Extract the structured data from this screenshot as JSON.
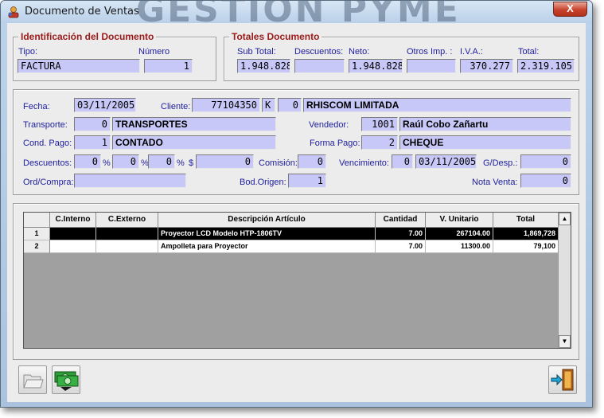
{
  "window": {
    "title": "Documento de Ventas",
    "watermark": "GESTION PYME",
    "close_label": "X"
  },
  "identificacion": {
    "title": "Identificación del Documento",
    "tipo_label": "Tipo:",
    "tipo_value": "FACTURA",
    "numero_label": "Número",
    "numero_value": "1"
  },
  "totales": {
    "title": "Totales Documento",
    "subtotal_label": "Sub Total:",
    "subtotal_value": "1.948.828",
    "descuentos_label": "Descuentos:",
    "descuentos_value": "",
    "neto_label": "Neto:",
    "neto_value": "1.948.828",
    "otros_label": "Otros Imp. :",
    "otros_value": "",
    "iva_label": "I.V.A.:",
    "iva_value": "370.277",
    "total_label": "Total:",
    "total_value": "2.319.105"
  },
  "form": {
    "fecha_label": "Fecha:",
    "fecha_value": "03/11/2005",
    "cliente_label": "Cliente:",
    "cliente_rut": "77104350",
    "cliente_dv": "K",
    "cliente_suc": "0",
    "cliente_nombre": "RHISCOM  LIMITADA",
    "transporte_label": "Transporte:",
    "transporte_code": "0",
    "transporte_name": "TRANSPORTES",
    "vendedor_label": "Vendedor:",
    "vendedor_code": "1001",
    "vendedor_name": "Raúl Cobo Zañartu",
    "condpago_label": "Cond. Pago:",
    "condpago_code": "1",
    "condpago_name": "CONTADO",
    "formapago_label": "Forma Pago:",
    "formapago_code": "2",
    "formapago_name": "CHEQUE",
    "descuentos_label": "Descuentos:",
    "desc1": "0",
    "desc2": "0",
    "desc3": "0",
    "desc_monto": "0",
    "pct": "%",
    "dollar": "$",
    "comision_label": "Comisión:",
    "comision_value": "0",
    "vencimiento_label": "Vencimiento:",
    "venc_dias": "0",
    "venc_fecha": "03/11/2005",
    "gdesp_label": "G/Desp.:",
    "gdesp_value": "0",
    "ordcompra_label": "Ord/Compra:",
    "ordcompra_value": "",
    "bodorigen_label": "Bod.Origen:",
    "bodorigen_value": "1",
    "notaventa_label": "Nota Venta:",
    "notaventa_value": "0"
  },
  "grid": {
    "headers": [
      "",
      "C.Interno",
      "C.Externo",
      "Descripción Artículo",
      "Cantidad",
      "V. Unitario",
      "Total"
    ],
    "rows": [
      {
        "idx": "1",
        "interno": "",
        "externo": "",
        "desc": "Proyector LCD Modelo HTP-1806TV",
        "cant": "7.00",
        "unit": "267104.00",
        "total": "1,869,728"
      },
      {
        "idx": "2",
        "interno": "",
        "externo": "",
        "desc": "Ampolleta para Proyector",
        "cant": "7.00",
        "unit": "11300.00",
        "total": "79,100"
      }
    ],
    "scroll_up": "▲",
    "scroll_down": "▼"
  },
  "toolbar": {
    "open_icon": "folder-icon",
    "save_icon": "money-icon",
    "exit_icon": "exit-door-icon"
  }
}
